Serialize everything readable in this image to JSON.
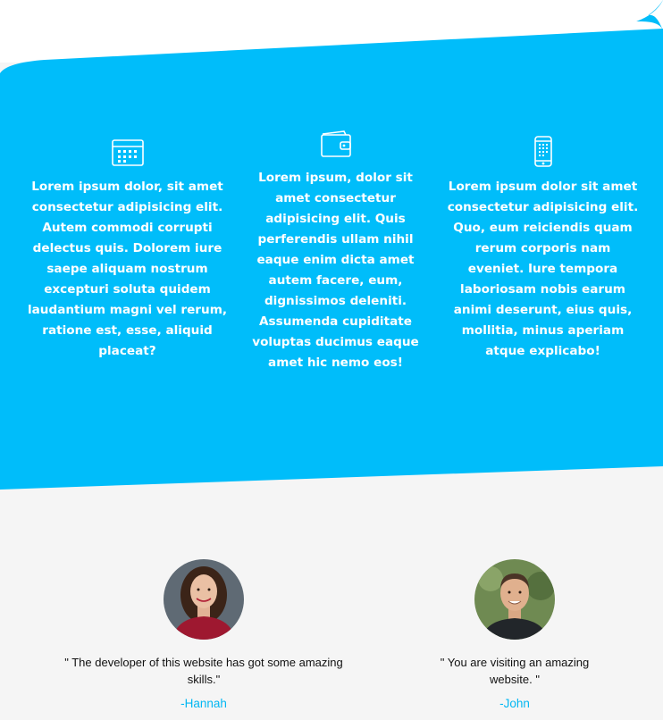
{
  "colors": {
    "band": "#00bdfa",
    "lower_background": "#f5f5f5",
    "author": "#03b7f2"
  },
  "features": [
    {
      "icon": "calendar-icon",
      "text": "Lorem ipsum dolor, sit amet consectetur adipisicing elit. Autem commodi corrupti delectus quis. Dolorem iure saepe aliquam nostrum excepturi soluta quidem laudantium magni vel rerum, ratione est, esse, aliquid placeat?"
    },
    {
      "icon": "wallet-icon",
      "text": "Lorem ipsum, dolor sit amet consectetur adipisicing elit. Quis perferendis ullam nihil eaque enim dicta amet autem facere, eum, dignissimos deleniti. Assumenda cupiditate voluptas ducimus eaque amet hic nemo eos!"
    },
    {
      "icon": "smartphone-icon",
      "text": "Lorem ipsum dolor sit amet consectetur adipisicing elit. Quo, eum reiciendis quam rerum corporis nam eveniet. Iure tempora laboriosam nobis earum animi deserunt, eius quis, mollitia, minus aperiam atque explicabo!"
    }
  ],
  "testimonials": [
    {
      "quote": "\" The developer of this website has got some amazing skills.\"",
      "author": "-Hannah"
    },
    {
      "quote": "\" You are visiting an amazing website. \"",
      "author": "-John"
    }
  ]
}
